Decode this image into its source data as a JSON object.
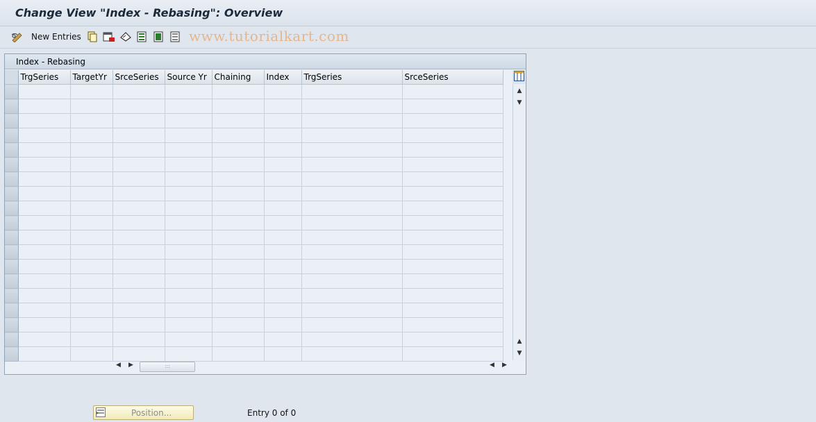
{
  "window": {
    "title": "Change View \"Index - Rebasing\": Overview"
  },
  "toolbar": {
    "new_entries_label": "New Entries",
    "watermark": "www.tutorialkart.com",
    "icons": [
      "edit-glasses-icon",
      "copy-icon",
      "delete-icon",
      "undo-change-icon",
      "select-all-icon",
      "select-block-icon",
      "deselect-all-icon"
    ]
  },
  "table": {
    "panel_title": "Index - Rebasing",
    "columns": [
      "TrgSeries",
      "TargetYr",
      "SrceSeries",
      "Source Yr",
      "Chaining",
      "Index",
      "TrgSeries",
      "SrceSeries"
    ],
    "rows": [
      [
        "",
        "",
        "",
        "",
        "",
        "",
        "",
        ""
      ],
      [
        "",
        "",
        "",
        "",
        "",
        "",
        "",
        ""
      ],
      [
        "",
        "",
        "",
        "",
        "",
        "",
        "",
        ""
      ],
      [
        "",
        "",
        "",
        "",
        "",
        "",
        "",
        ""
      ],
      [
        "",
        "",
        "",
        "",
        "",
        "",
        "",
        ""
      ],
      [
        "",
        "",
        "",
        "",
        "",
        "",
        "",
        ""
      ],
      [
        "",
        "",
        "",
        "",
        "",
        "",
        "",
        ""
      ],
      [
        "",
        "",
        "",
        "",
        "",
        "",
        "",
        ""
      ],
      [
        "",
        "",
        "",
        "",
        "",
        "",
        "",
        ""
      ],
      [
        "",
        "",
        "",
        "",
        "",
        "",
        "",
        ""
      ],
      [
        "",
        "",
        "",
        "",
        "",
        "",
        "",
        ""
      ],
      [
        "",
        "",
        "",
        "",
        "",
        "",
        "",
        ""
      ],
      [
        "",
        "",
        "",
        "",
        "",
        "",
        "",
        ""
      ],
      [
        "",
        "",
        "",
        "",
        "",
        "",
        "",
        ""
      ],
      [
        "",
        "",
        "",
        "",
        "",
        "",
        "",
        ""
      ],
      [
        "",
        "",
        "",
        "",
        "",
        "",
        "",
        ""
      ],
      [
        "",
        "",
        "",
        "",
        "",
        "",
        "",
        ""
      ],
      [
        "",
        "",
        "",
        "",
        "",
        "",
        "",
        ""
      ],
      [
        "",
        "",
        "",
        "",
        "",
        "",
        "",
        ""
      ]
    ]
  },
  "footer": {
    "position_label": "Position...",
    "entry_text": "Entry 0 of 0"
  },
  "colors": {
    "background": "#dfe6ee",
    "title_text": "#1b2a3a",
    "watermark": "#e5b68c",
    "position_button": "#f2ebb8"
  }
}
